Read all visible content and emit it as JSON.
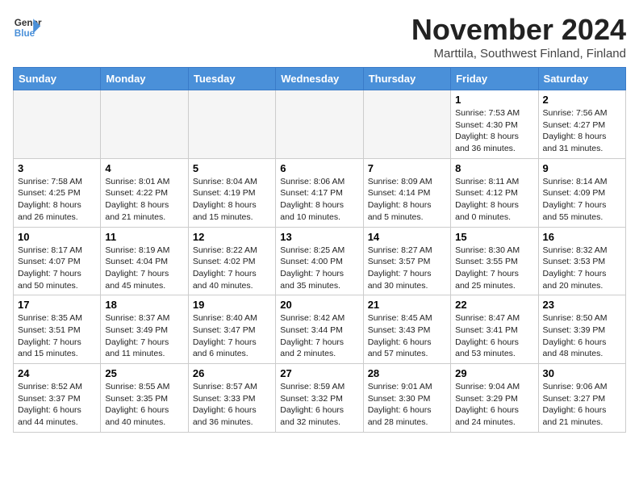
{
  "logo": {
    "line1": "General",
    "line2": "Blue"
  },
  "title": "November 2024",
  "location": "Marttila, Southwest Finland, Finland",
  "days_of_week": [
    "Sunday",
    "Monday",
    "Tuesday",
    "Wednesday",
    "Thursday",
    "Friday",
    "Saturday"
  ],
  "weeks": [
    [
      {
        "day": "",
        "info": "",
        "empty": true
      },
      {
        "day": "",
        "info": "",
        "empty": true
      },
      {
        "day": "",
        "info": "",
        "empty": true
      },
      {
        "day": "",
        "info": "",
        "empty": true
      },
      {
        "day": "",
        "info": "",
        "empty": true
      },
      {
        "day": "1",
        "info": "Sunrise: 7:53 AM\nSunset: 4:30 PM\nDaylight: 8 hours and 36 minutes.",
        "empty": false
      },
      {
        "day": "2",
        "info": "Sunrise: 7:56 AM\nSunset: 4:27 PM\nDaylight: 8 hours and 31 minutes.",
        "empty": false
      }
    ],
    [
      {
        "day": "3",
        "info": "Sunrise: 7:58 AM\nSunset: 4:25 PM\nDaylight: 8 hours and 26 minutes.",
        "empty": false
      },
      {
        "day": "4",
        "info": "Sunrise: 8:01 AM\nSunset: 4:22 PM\nDaylight: 8 hours and 21 minutes.",
        "empty": false
      },
      {
        "day": "5",
        "info": "Sunrise: 8:04 AM\nSunset: 4:19 PM\nDaylight: 8 hours and 15 minutes.",
        "empty": false
      },
      {
        "day": "6",
        "info": "Sunrise: 8:06 AM\nSunset: 4:17 PM\nDaylight: 8 hours and 10 minutes.",
        "empty": false
      },
      {
        "day": "7",
        "info": "Sunrise: 8:09 AM\nSunset: 4:14 PM\nDaylight: 8 hours and 5 minutes.",
        "empty": false
      },
      {
        "day": "8",
        "info": "Sunrise: 8:11 AM\nSunset: 4:12 PM\nDaylight: 8 hours and 0 minutes.",
        "empty": false
      },
      {
        "day": "9",
        "info": "Sunrise: 8:14 AM\nSunset: 4:09 PM\nDaylight: 7 hours and 55 minutes.",
        "empty": false
      }
    ],
    [
      {
        "day": "10",
        "info": "Sunrise: 8:17 AM\nSunset: 4:07 PM\nDaylight: 7 hours and 50 minutes.",
        "empty": false
      },
      {
        "day": "11",
        "info": "Sunrise: 8:19 AM\nSunset: 4:04 PM\nDaylight: 7 hours and 45 minutes.",
        "empty": false
      },
      {
        "day": "12",
        "info": "Sunrise: 8:22 AM\nSunset: 4:02 PM\nDaylight: 7 hours and 40 minutes.",
        "empty": false
      },
      {
        "day": "13",
        "info": "Sunrise: 8:25 AM\nSunset: 4:00 PM\nDaylight: 7 hours and 35 minutes.",
        "empty": false
      },
      {
        "day": "14",
        "info": "Sunrise: 8:27 AM\nSunset: 3:57 PM\nDaylight: 7 hours and 30 minutes.",
        "empty": false
      },
      {
        "day": "15",
        "info": "Sunrise: 8:30 AM\nSunset: 3:55 PM\nDaylight: 7 hours and 25 minutes.",
        "empty": false
      },
      {
        "day": "16",
        "info": "Sunrise: 8:32 AM\nSunset: 3:53 PM\nDaylight: 7 hours and 20 minutes.",
        "empty": false
      }
    ],
    [
      {
        "day": "17",
        "info": "Sunrise: 8:35 AM\nSunset: 3:51 PM\nDaylight: 7 hours and 15 minutes.",
        "empty": false
      },
      {
        "day": "18",
        "info": "Sunrise: 8:37 AM\nSunset: 3:49 PM\nDaylight: 7 hours and 11 minutes.",
        "empty": false
      },
      {
        "day": "19",
        "info": "Sunrise: 8:40 AM\nSunset: 3:47 PM\nDaylight: 7 hours and 6 minutes.",
        "empty": false
      },
      {
        "day": "20",
        "info": "Sunrise: 8:42 AM\nSunset: 3:44 PM\nDaylight: 7 hours and 2 minutes.",
        "empty": false
      },
      {
        "day": "21",
        "info": "Sunrise: 8:45 AM\nSunset: 3:43 PM\nDaylight: 6 hours and 57 minutes.",
        "empty": false
      },
      {
        "day": "22",
        "info": "Sunrise: 8:47 AM\nSunset: 3:41 PM\nDaylight: 6 hours and 53 minutes.",
        "empty": false
      },
      {
        "day": "23",
        "info": "Sunrise: 8:50 AM\nSunset: 3:39 PM\nDaylight: 6 hours and 48 minutes.",
        "empty": false
      }
    ],
    [
      {
        "day": "24",
        "info": "Sunrise: 8:52 AM\nSunset: 3:37 PM\nDaylight: 6 hours and 44 minutes.",
        "empty": false
      },
      {
        "day": "25",
        "info": "Sunrise: 8:55 AM\nSunset: 3:35 PM\nDaylight: 6 hours and 40 minutes.",
        "empty": false
      },
      {
        "day": "26",
        "info": "Sunrise: 8:57 AM\nSunset: 3:33 PM\nDaylight: 6 hours and 36 minutes.",
        "empty": false
      },
      {
        "day": "27",
        "info": "Sunrise: 8:59 AM\nSunset: 3:32 PM\nDaylight: 6 hours and 32 minutes.",
        "empty": false
      },
      {
        "day": "28",
        "info": "Sunrise: 9:01 AM\nSunset: 3:30 PM\nDaylight: 6 hours and 28 minutes.",
        "empty": false
      },
      {
        "day": "29",
        "info": "Sunrise: 9:04 AM\nSunset: 3:29 PM\nDaylight: 6 hours and 24 minutes.",
        "empty": false
      },
      {
        "day": "30",
        "info": "Sunrise: 9:06 AM\nSunset: 3:27 PM\nDaylight: 6 hours and 21 minutes.",
        "empty": false
      }
    ]
  ]
}
